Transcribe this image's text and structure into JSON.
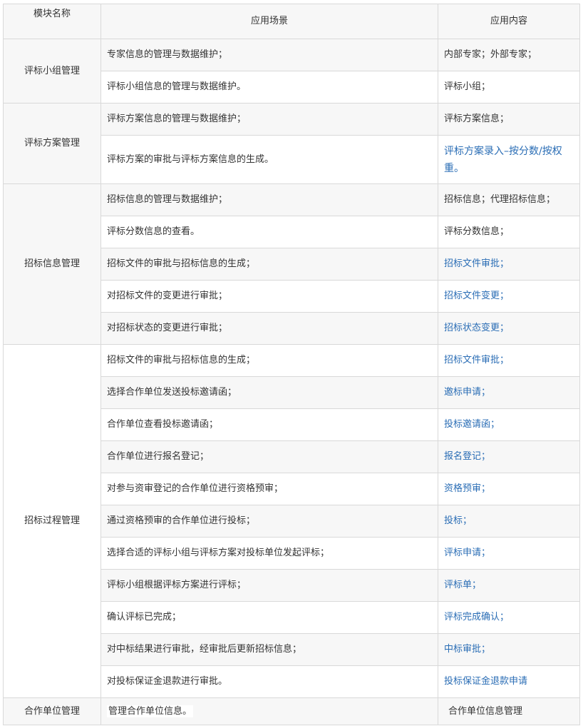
{
  "headers": [
    "模块名称",
    "应用场景",
    "应用内容"
  ],
  "modules": [
    {
      "name": "评标小组管理",
      "rows": [
        {
          "scene": "专家信息的管理与数据维护；",
          "content": "内部专家；外部专家；",
          "link": false
        },
        {
          "scene": "评标小组信息的管理与数据维护。",
          "content": "评标小组；",
          "link": false
        }
      ]
    },
    {
      "name": "评标方案管理",
      "rows": [
        {
          "scene": "评标方案信息的管理与数据维护；",
          "content": "评标方案信息；",
          "link": false
        },
        {
          "scene": "评标方案的审批与评标方案信息的生成。",
          "content": "评标方案录入–按分数/按权重。",
          "link": true
        }
      ]
    },
    {
      "name": "招标信息管理",
      "rows": [
        {
          "scene": "招标信息的管理与数据维护；",
          "content": "招标信息；代理招标信息；",
          "link": false
        },
        {
          "scene": "评标分数信息的查看。",
          "content": "评标分数信息；",
          "link": false
        },
        {
          "scene": "招标文件的审批与招标信息的生成；",
          "content": "招标文件审批；",
          "link": true
        },
        {
          "scene": "对招标文件的变更进行审批；",
          "content": "招标文件变更；",
          "link": true
        },
        {
          "scene": "对招标状态的变更进行审批；",
          "content": "招标状态变更；",
          "link": true
        }
      ]
    },
    {
      "name": "招标过程管理",
      "rows": [
        {
          "scene": "招标文件的审批与招标信息的生成；",
          "content": "招标文件审批；",
          "link": true
        },
        {
          "scene": "选择合作单位发送投标邀请函；",
          "content": "邀标申请；",
          "link": true
        },
        {
          "scene": "合作单位查看投标邀请函；",
          "content": "投标邀请函；",
          "link": true
        },
        {
          "scene": "合作单位进行报名登记；",
          "content": "报名登记；",
          "link": true
        },
        {
          "scene": "对参与资审登记的合作单位进行资格预审；",
          "content": "资格预审；",
          "link": true
        },
        {
          "scene": "通过资格预审的合作单位进行投标；",
          "content": "投标；",
          "link": true
        },
        {
          "scene": "选择合适的评标小组与评标方案对投标单位发起评标；",
          "content": "评标申请；",
          "link": true
        },
        {
          "scene": "评标小组根据评标方案进行评标；",
          "content": "评标单；",
          "link": true
        },
        {
          "scene": "确认评标已完成；",
          "content": "评标完成确认；",
          "link": true
        },
        {
          "scene": "对中标结果进行审批，经审批后更新招标信息；",
          "content": "中标审批；",
          "link": true
        },
        {
          "scene": "对投标保证金退款进行审批。",
          "content": "投标保证金退款申请",
          "link": true
        }
      ]
    },
    {
      "name": "合作单位管理",
      "rows": [
        {
          "scene": "管理合作单位信息。",
          "content": "合作单位信息管理",
          "link": false
        }
      ]
    }
  ]
}
